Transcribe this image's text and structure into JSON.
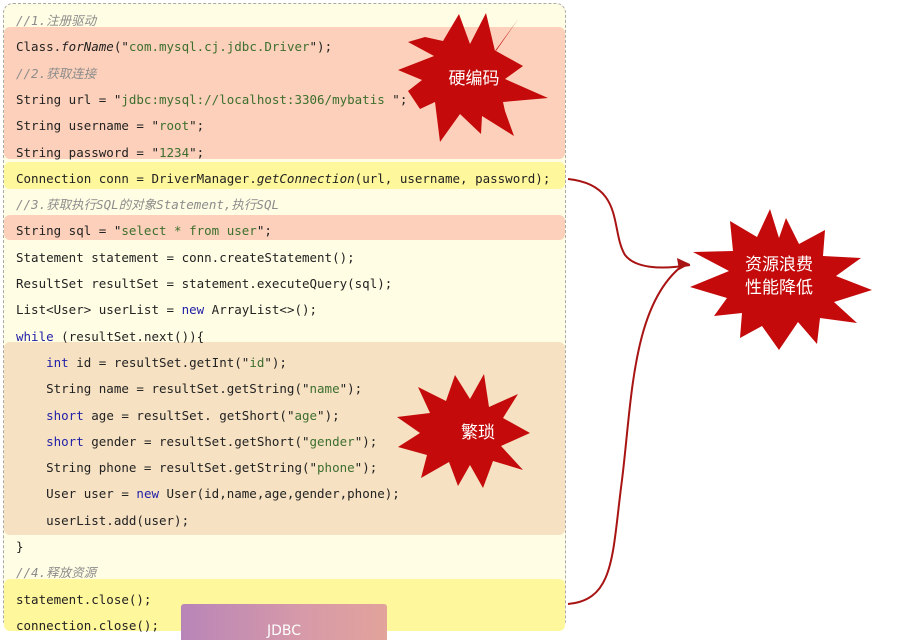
{
  "code": {
    "lines": [
      {
        "segments": [
          {
            "t": "//1.注册驱动",
            "c": "comment"
          }
        ]
      },
      {
        "segments": [
          {
            "t": "Class."
          },
          {
            "t": "forName",
            "c": "it"
          },
          {
            "t": "(\""
          },
          {
            "t": "com.mysql.cj.jdbc.Driver",
            "c": "str"
          },
          {
            "t": "\");"
          }
        ]
      },
      {
        "segments": [
          {
            "t": "//2.获取连接",
            "c": "comment"
          }
        ]
      },
      {
        "segments": [
          {
            "t": "String url = \""
          },
          {
            "t": "jdbc:mysql://localhost:3306/mybatis ",
            "c": "str"
          },
          {
            "t": "\";"
          }
        ]
      },
      {
        "segments": [
          {
            "t": "String username = \""
          },
          {
            "t": "root",
            "c": "str"
          },
          {
            "t": "\";"
          }
        ]
      },
      {
        "segments": [
          {
            "t": "String password = \""
          },
          {
            "t": "1234",
            "c": "str"
          },
          {
            "t": "\";"
          }
        ]
      },
      {
        "segments": [
          {
            "t": "Connection conn = DriverManager."
          },
          {
            "t": "getConnection",
            "c": "it"
          },
          {
            "t": "(url, username, password);"
          }
        ]
      },
      {
        "segments": [
          {
            "t": "//3.获取执行SQL的对象Statement,执行SQL",
            "c": "comment"
          }
        ]
      },
      {
        "segments": [
          {
            "t": "String sql = \""
          },
          {
            "t": "select * from user",
            "c": "str"
          },
          {
            "t": "\";"
          }
        ]
      },
      {
        "segments": [
          {
            "t": "Statement statement = conn.createStatement();"
          }
        ]
      },
      {
        "segments": [
          {
            "t": "ResultSet resultSet = statement.executeQuery(sql);"
          }
        ]
      },
      {
        "segments": [
          {
            "t": "List<User> userList = "
          },
          {
            "t": "new",
            "c": "kw"
          },
          {
            "t": " ArrayList<>();"
          }
        ]
      },
      {
        "segments": [
          {
            "t": "while",
            "c": "kw"
          },
          {
            "t": " (resultSet.next()){"
          }
        ]
      },
      {
        "segments": [
          {
            "t": "    "
          },
          {
            "t": "int",
            "c": "kw"
          },
          {
            "t": " id = resultSet.getInt(\""
          },
          {
            "t": "id",
            "c": "str"
          },
          {
            "t": "\");"
          }
        ]
      },
      {
        "segments": [
          {
            "t": "    String name = resultSet.getString(\""
          },
          {
            "t": "name",
            "c": "str"
          },
          {
            "t": "\");"
          }
        ]
      },
      {
        "segments": [
          {
            "t": "    "
          },
          {
            "t": "short",
            "c": "kw"
          },
          {
            "t": " age = resultSet. getShort(\""
          },
          {
            "t": "age",
            "c": "str"
          },
          {
            "t": "\");"
          }
        ]
      },
      {
        "segments": [
          {
            "t": "    "
          },
          {
            "t": "short",
            "c": "kw"
          },
          {
            "t": " gender = resultSet.getShort(\""
          },
          {
            "t": "gender",
            "c": "str"
          },
          {
            "t": "\");"
          }
        ]
      },
      {
        "segments": [
          {
            "t": "    String phone = resultSet.getString(\""
          },
          {
            "t": "phone",
            "c": "str"
          },
          {
            "t": "\");"
          }
        ]
      },
      {
        "segments": [
          {
            "t": "    User user = "
          },
          {
            "t": "new",
            "c": "kw"
          },
          {
            "t": " User(id,name,age,gender,phone);"
          }
        ]
      },
      {
        "segments": [
          {
            "t": "    userList.add(user);"
          }
        ]
      },
      {
        "segments": [
          {
            "t": "}"
          }
        ]
      },
      {
        "segments": [
          {
            "t": "//4.释放资源",
            "c": "comment"
          }
        ]
      },
      {
        "segments": [
          {
            "t": "statement.close();"
          }
        ]
      },
      {
        "segments": [
          {
            "t": "connection.close();"
          }
        ]
      }
    ]
  },
  "annotations": {
    "hardcode": "硬编码",
    "tedious": "繁琐",
    "waste_line1": "资源浪费",
    "waste_line2": "性能降低"
  },
  "tab": {
    "label": "JDBC"
  },
  "colors": {
    "burst": "#c40a0a",
    "arrow": "#a81414",
    "highlight_hardcode": "#fcd0ba",
    "highlight_resource": "#fff79c",
    "highlight_tedious": "#f6e1c2"
  }
}
